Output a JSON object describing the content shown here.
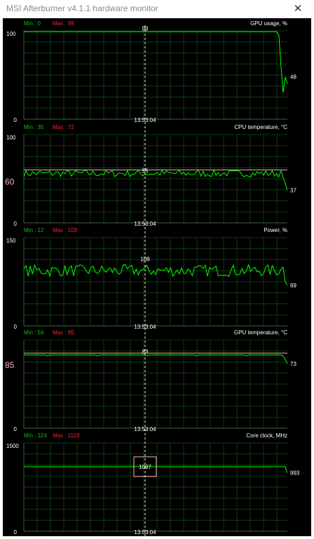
{
  "window": {
    "title": "MSI Afterburner v4.1.1 hardware monitor",
    "close_icon": "close-icon"
  },
  "cursor_time": "13:53:04",
  "colors": {
    "background": "#000000",
    "grid": "#0d3d0d",
    "axis": "#2e6e2e",
    "line": "#00ff00",
    "min_label": "#00c800",
    "max_label": "#ff2020",
    "threshold": "#ffb0b0",
    "text": "#ffffff",
    "cursor": "#ffffc8"
  },
  "chart_data": [
    {
      "type": "line",
      "title": "GPU usage, %",
      "ylim": [
        0,
        100
      ],
      "ymax_label": "100",
      "ymin_label": "0",
      "min_text": "Min : 0",
      "max_text": "Max : 99",
      "cursor_value": "99",
      "current_value": "48",
      "threshold": null,
      "threshold_label": "",
      "cursor_box": false,
      "shape": "flat_then_drop",
      "base": 99,
      "noise": 0,
      "end_values": [
        95,
        60,
        30,
        48,
        40
      ]
    },
    {
      "type": "line",
      "title": "CPU temperature, °C",
      "ylim": [
        0,
        100
      ],
      "ymax_label": "100",
      "ymin_label": "0",
      "min_text": "Min : 35",
      "max_text": "Max : 72",
      "cursor_value": "55",
      "current_value": "37",
      "threshold": 60,
      "threshold_label": "60",
      "cursor_box": false,
      "shape": "noisy",
      "base": 56,
      "noise": 4,
      "end_values": [
        52,
        45,
        37
      ]
    },
    {
      "type": "line",
      "title": "Power, %",
      "ylim": [
        0,
        150
      ],
      "ymax_label": "150",
      "ymin_label": "0",
      "min_text": "Min : 12",
      "max_text": "Max : 109",
      "cursor_value": "108",
      "current_value": "69",
      "threshold": null,
      "threshold_label": "",
      "cursor_box": false,
      "shape": "noisy",
      "base": 94,
      "noise": 10,
      "end_values": [
        100,
        75,
        69
      ]
    },
    {
      "type": "line",
      "title": "GPU temperature, °C",
      "ylim": [
        0,
        100
      ],
      "ymax_label": "",
      "ymin_label": "0",
      "min_text": "Min : 54",
      "max_text": "Max : 85",
      "cursor_value": "83",
      "current_value": "73",
      "threshold": 85,
      "threshold_label": "85",
      "cursor_box": false,
      "shape": "flat_dips",
      "base": 83,
      "noise": 1,
      "end_values": [
        82,
        78,
        73
      ]
    },
    {
      "type": "line",
      "title": "Core clock, MHz",
      "ylim": [
        0,
        1500
      ],
      "ymax_label": "1500",
      "ymin_label": "0",
      "min_text": "Min : 324",
      "max_text": "Max : 1118",
      "cursor_value": "1097",
      "current_value": "993",
      "threshold": null,
      "threshold_label": "",
      "cursor_box": true,
      "shape": "flat",
      "base": 1097,
      "noise": 0,
      "end_values": [
        1097,
        993
      ]
    }
  ]
}
